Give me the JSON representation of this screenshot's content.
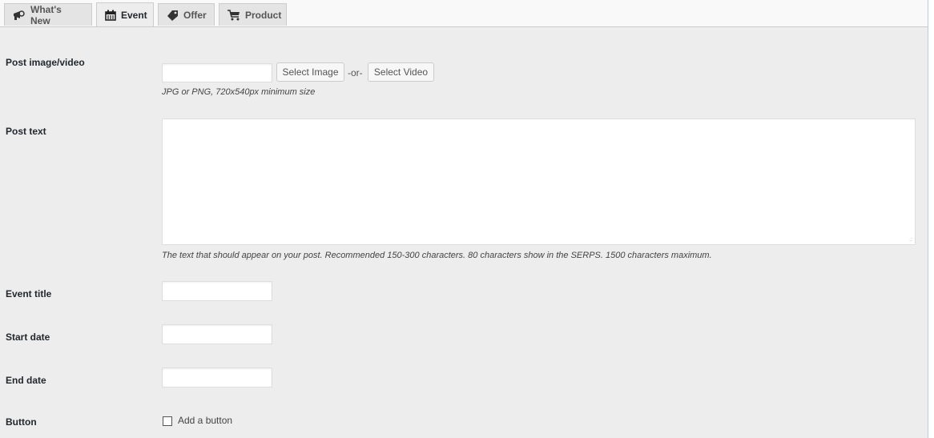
{
  "tabs": [
    {
      "label": "What's New",
      "icon": "megaphone-icon",
      "active": false
    },
    {
      "label": "Event",
      "icon": "calendar-icon",
      "active": true
    },
    {
      "label": "Offer",
      "icon": "tag-icon",
      "active": false
    },
    {
      "label": "Product",
      "icon": "cart-icon",
      "active": false
    }
  ],
  "form": {
    "post_image": {
      "label": "Post image/video",
      "value": "",
      "select_image_label": "Select Image",
      "or_text": "-or-",
      "select_video_label": "Select Video",
      "hint": "JPG or PNG, 720x540px minimum size"
    },
    "post_text": {
      "label": "Post text",
      "value": "",
      "hint": "The text that should appear on your post. Recommended 150-300 characters. 80 characters show in the SERPS. 1500 characters maximum."
    },
    "event_title": {
      "label": "Event title",
      "value": ""
    },
    "start_date": {
      "label": "Start date",
      "value": ""
    },
    "end_date": {
      "label": "End date",
      "value": ""
    },
    "button": {
      "label": "Button",
      "checkbox_label": "Add a button",
      "checked": false
    }
  }
}
